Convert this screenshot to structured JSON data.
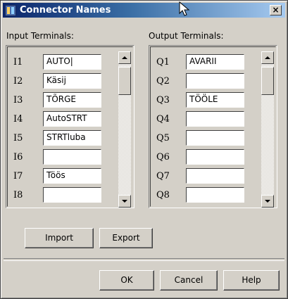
{
  "window": {
    "title": "Connector Names",
    "close_label": "×"
  },
  "input_panel": {
    "label": "Input Terminals:",
    "rows": [
      {
        "id": "I1",
        "value": "AUTO|"
      },
      {
        "id": "I2",
        "value": "Käsij"
      },
      {
        "id": "I3",
        "value": "TÕRGE"
      },
      {
        "id": "I4",
        "value": "AutoSTRT"
      },
      {
        "id": "I5",
        "value": "STRTluba"
      },
      {
        "id": "I6",
        "value": ""
      },
      {
        "id": "I7",
        "value": "Töös"
      },
      {
        "id": "I8",
        "value": ""
      }
    ]
  },
  "output_panel": {
    "label": "Output Terminals:",
    "rows": [
      {
        "id": "Q1",
        "value": "AVARII"
      },
      {
        "id": "Q2",
        "value": ""
      },
      {
        "id": "Q3",
        "value": "TÖÖLE"
      },
      {
        "id": "Q4",
        "value": ""
      },
      {
        "id": "Q5",
        "value": ""
      },
      {
        "id": "Q6",
        "value": ""
      },
      {
        "id": "Q7",
        "value": ""
      },
      {
        "id": "Q8",
        "value": ""
      }
    ]
  },
  "buttons": {
    "import": "Import",
    "export": "Export",
    "ok": "OK",
    "cancel": "Cancel",
    "help": "Help"
  }
}
